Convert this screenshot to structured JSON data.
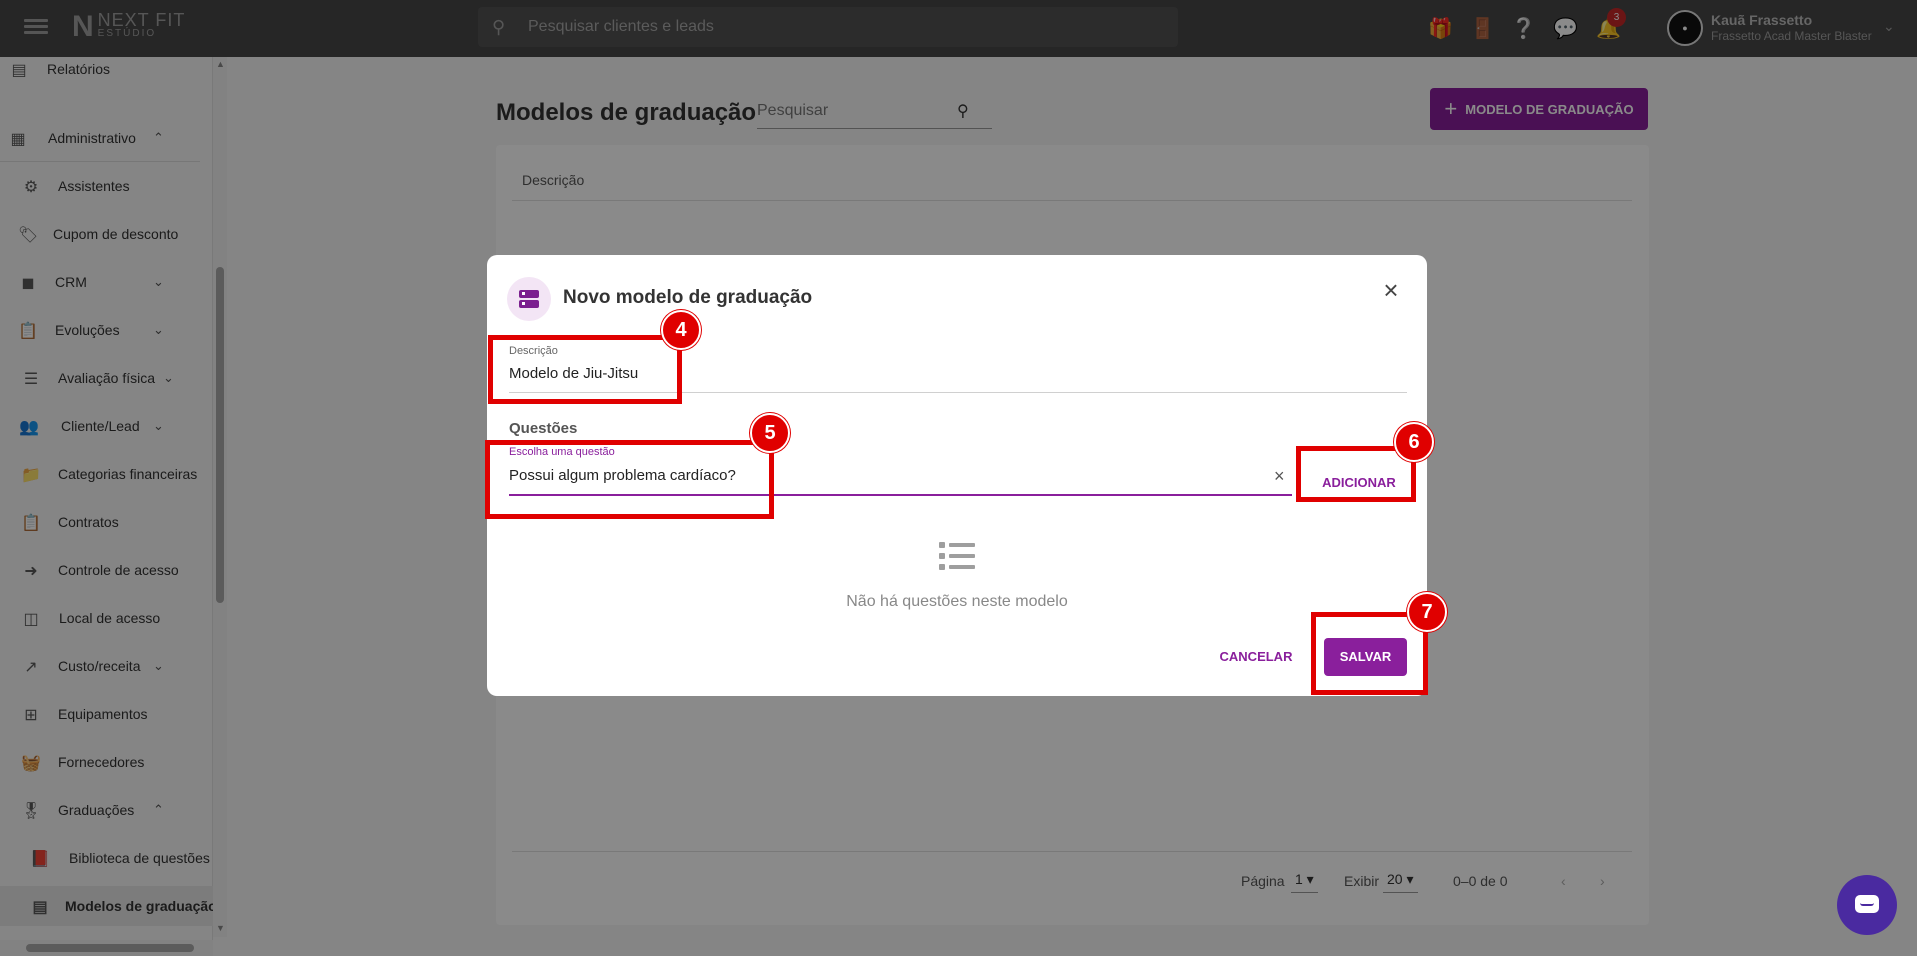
{
  "topbar": {
    "logo_main": "NEXT FIT",
    "logo_sub": "ESTÚDIO",
    "search_placeholder": "Pesquisar clientes e leads",
    "notification_count": "3",
    "user_name": "Kauã Frassetto",
    "user_company": "Frassetto Acad Master Blaster"
  },
  "sidebar": {
    "items": [
      {
        "label": "Relatórios"
      },
      {
        "label": "Administrativo"
      },
      {
        "label": "Assistentes"
      },
      {
        "label": "Cupom de desconto"
      },
      {
        "label": "CRM"
      },
      {
        "label": "Evoluções"
      },
      {
        "label": "Avaliação física"
      },
      {
        "label": "Cliente/Lead"
      },
      {
        "label": "Categorias financeiras"
      },
      {
        "label": "Contratos"
      },
      {
        "label": "Controle de acesso"
      },
      {
        "label": "Local de acesso"
      },
      {
        "label": "Custo/receita"
      },
      {
        "label": "Equipamentos"
      },
      {
        "label": "Fornecedores"
      },
      {
        "label": "Graduações"
      },
      {
        "label": "Biblioteca de questões"
      },
      {
        "label": "Modelos de graduação"
      }
    ]
  },
  "main": {
    "title": "Modelos de graduação",
    "search_placeholder": "Pesquisar",
    "add_button": "MODELO DE GRADUAÇÃO",
    "column_header": "Descrição",
    "pager": {
      "page_label": "Página",
      "page_value": "1",
      "show_label": "Exibir",
      "show_value": "20",
      "range": "0–0 de 0"
    }
  },
  "dialog": {
    "title": "Novo modelo de graduação",
    "description_label": "Descrição",
    "description_value": "Modelo de Jiu-Jitsu",
    "questions_title": "Questões",
    "question_label": "Escolha uma questão",
    "question_value": "Possui algum problema cardíaco?",
    "add_button": "ADICIONAR",
    "empty_text": "Não há questões neste modelo",
    "cancel_button": "CANCELAR",
    "save_button": "SALVAR"
  },
  "annotations": [
    "4",
    "5",
    "6",
    "7"
  ],
  "colors": {
    "accent": "#8a1f9c",
    "topbar": "#464646",
    "annotation": "#e00000",
    "chat": "#4a2aa0"
  }
}
